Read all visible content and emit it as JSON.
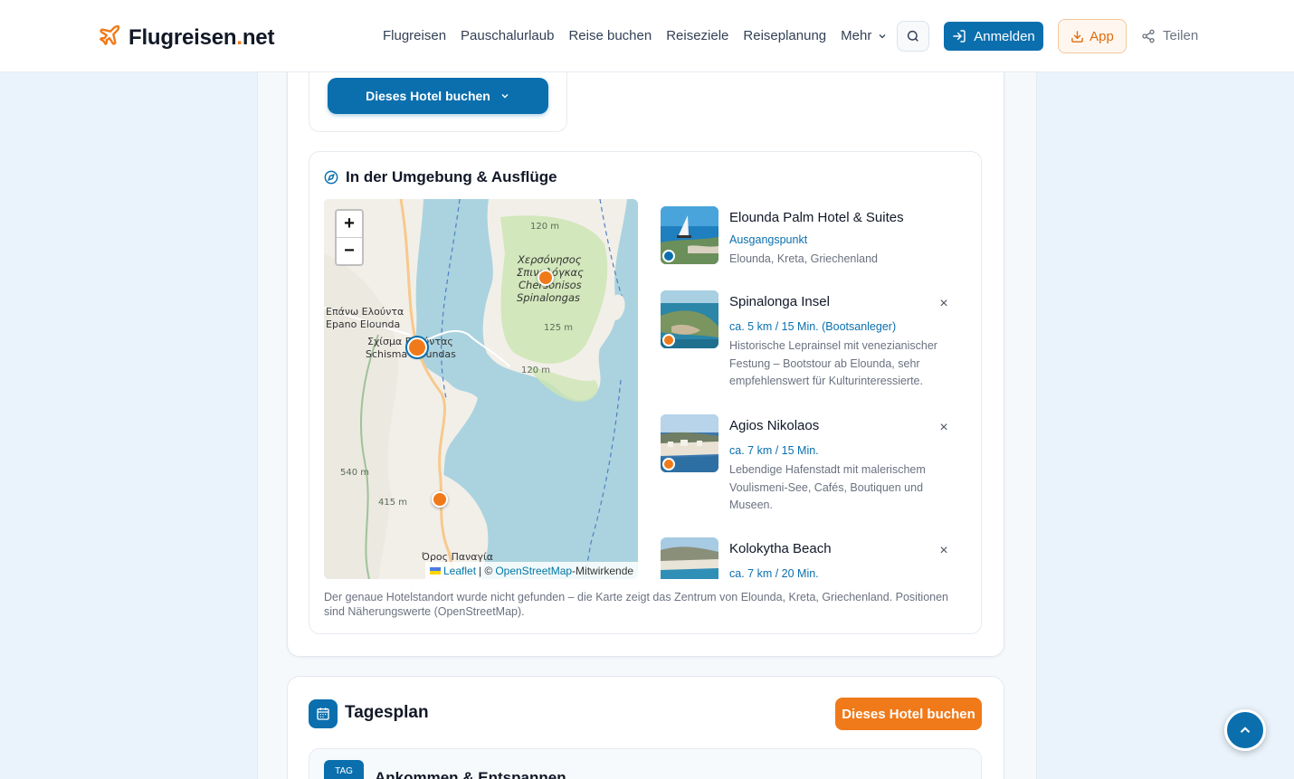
{
  "header": {
    "logo_main": "Flugreisen",
    "logo_dot": ".",
    "logo_tld": "net",
    "nav": [
      "Flugreisen",
      "Pauschalurlaub",
      "Reise buchen",
      "Reiseziele",
      "Reiseplanung",
      "Mehr"
    ],
    "login_label": "Anmelden",
    "app_label": "App",
    "share_label": "Teilen"
  },
  "booking": {
    "button_label": "Dieses Hotel buchen"
  },
  "surroundings": {
    "title": "In der Umgebung & Ausflüge",
    "map": {
      "zoom_in": "+",
      "zoom_out": "−",
      "attribution_leaflet": "Leaflet",
      "attribution_sep": "| ©",
      "attribution_osm": "OpenStreetMap",
      "attribution_suffix": "-Mitwirkende",
      "labels": {
        "chersonisos_gr1": "Χερσόνησος",
        "chersonisos_gr2": "Σπιναλόγκας",
        "chersonisos_lat1": "Chersonisos",
        "chersonisos_lat2": "Spinalongas",
        "epano_gr": "Επάνω Ελούντα",
        "epano_lat": "Epano Elounda",
        "schisma_gr": "Σχίσμα Ελούντας",
        "schisma_lat": "Schisma Eloundas",
        "oros": "Όρος Παναγία",
        "elev_120a": "120 m",
        "elev_125": "125 m",
        "elev_120b": "120 m",
        "elev_540": "540 m",
        "elev_415": "415 m"
      }
    },
    "items": [
      {
        "name": "Elounda Palm Hotel & Suites",
        "meta": "Ausgangspunkt",
        "desc": "Elounda, Kreta, Griechenland",
        "dot_color": "#0b6fae"
      },
      {
        "name": "Spinalonga Insel",
        "meta": "ca. 5 km / 15 Min. (Bootsanleger)",
        "desc": "Historische Leprainsel mit venezianischer Festung – Bootstour ab Elounda, sehr empfehlenswert für Kulturinteressierte.",
        "dot_color": "#f07a1a"
      },
      {
        "name": "Agios Nikolaos",
        "meta": "ca. 7 km / 15 Min.",
        "desc": "Lebendige Hafenstadt mit malerischem Voulismeni-See, Cafés, Boutiquen und Museen.",
        "dot_color": "#f07a1a"
      },
      {
        "name": "Kolokytha Beach",
        "meta": "ca. 7 km / 20 Min.",
        "desc": "",
        "dot_color": "#f07a1a"
      }
    ],
    "note": "Der genaue Hotelstandort wurde nicht gefunden – die Karte zeigt das Zentrum von Elounda, Kreta, Griechenland. Positionen sind Näherungswerte (OpenStreetMap)."
  },
  "dayplan": {
    "title": "Tagesplan",
    "book_label": "Dieses Hotel buchen",
    "day_badge": "TAG",
    "day_title": "Ankommen & Entspannen"
  },
  "colors": {
    "primary": "#0b6fae",
    "accent": "#f07a1a"
  }
}
